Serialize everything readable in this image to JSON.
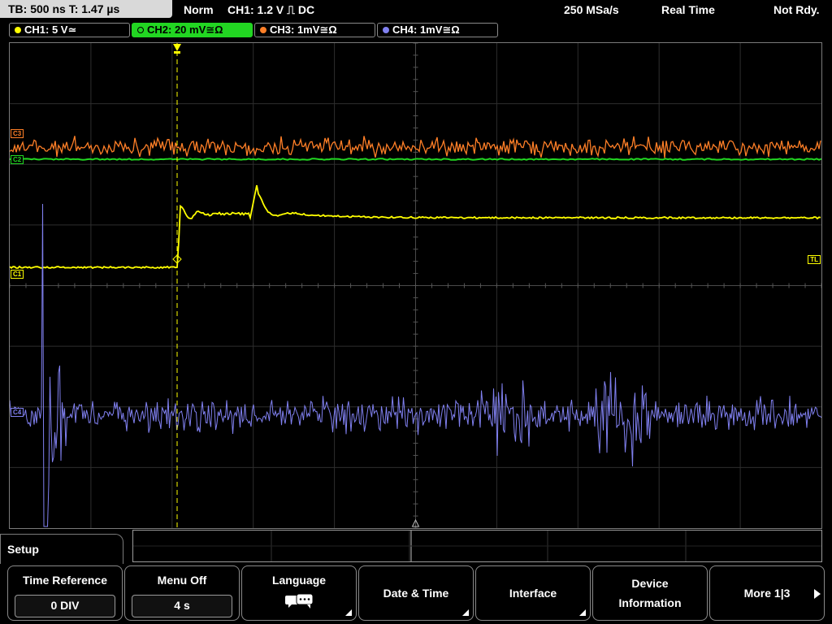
{
  "topbar": {
    "timebase": "TB: 500 ns   T: 1.47 µs",
    "mode": "Norm",
    "trigger": "CH1: 1.2 V ⎍ DC",
    "sample_rate": "250 MSa/s",
    "acq_mode": "Real Time",
    "status": "Not Rdy."
  },
  "channels": [
    {
      "label": "CH1: 5 V≃",
      "color": "#ffff00",
      "active": false
    },
    {
      "label": "CH2: 20 mV≅Ω",
      "color": "#22d622",
      "active": true
    },
    {
      "label": "CH3: 1mV≅Ω",
      "color": "#ff7f27",
      "active": false
    },
    {
      "label": "CH4: 1mV≅Ω",
      "color": "#8080f0",
      "active": false
    }
  ],
  "markers": {
    "c3": "C3",
    "c2": "C2",
    "c1": "C1",
    "c4": "C4",
    "trigger_level": "TL"
  },
  "menu": {
    "title": "Setup",
    "softkeys": [
      {
        "label": "Time Reference",
        "value": "0 DIV"
      },
      {
        "label": "Menu Off",
        "value": "4 s"
      },
      {
        "label": "Language",
        "icon": "speech-bubbles-icon"
      },
      {
        "label": "Date & Time"
      },
      {
        "label": "Interface"
      },
      {
        "label": "Device Information"
      },
      {
        "label": "More 1|3"
      }
    ]
  }
}
